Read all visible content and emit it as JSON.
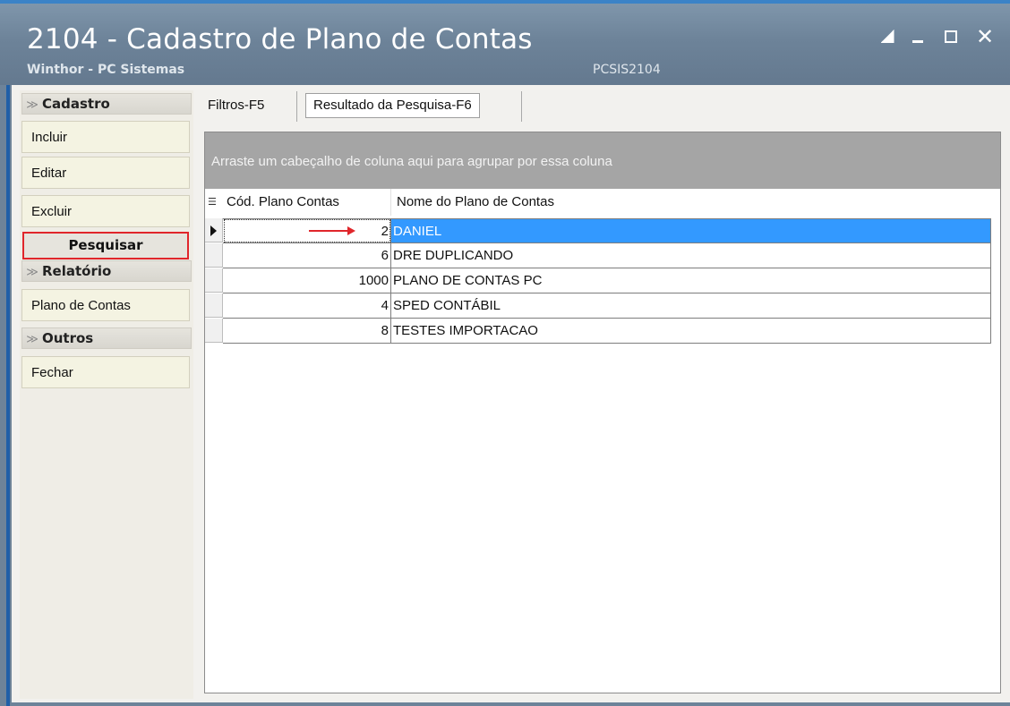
{
  "window": {
    "title": "2104 - Cadastro de Plano de Contas",
    "subtitle": "Winthor - PC Sistemas",
    "program_code": "PCSIS2104",
    "controls": [
      "restore-icon",
      "minimize-icon",
      "maximize-icon",
      "close-icon"
    ]
  },
  "sidebar": {
    "groups": [
      {
        "label": "Cadastro",
        "items": [
          {
            "label": "Incluir"
          },
          {
            "label": "Editar"
          },
          {
            "label": "Excluir"
          },
          {
            "label": "Pesquisar"
          }
        ]
      },
      {
        "label": "Relatório",
        "items": [
          {
            "label": "Plano de Contas"
          }
        ]
      },
      {
        "label": "Outros",
        "items": [
          {
            "label": "Fechar"
          }
        ]
      }
    ],
    "highlight_color": "#e0262b"
  },
  "tabs": [
    {
      "label": "Filtros-F5"
    },
    {
      "label": "Resultado da Pesquisa-F6"
    }
  ],
  "grid": {
    "group_panel_text": "Arraste um cabeçalho de coluna aqui para agrupar por essa coluna",
    "columns": [
      "Cód. Plano Contas",
      "Nome do Plano de Contas"
    ],
    "rows": [
      {
        "cod": "2",
        "nome": "DANIEL"
      },
      {
        "cod": "6",
        "nome": "DRE DUPLICANDO"
      },
      {
        "cod": "1000",
        "nome": "PLANO DE CONTAS PC"
      },
      {
        "cod": "4",
        "nome": "SPED CONTÁBIL"
      },
      {
        "cod": "8",
        "nome": "TESTES IMPORTACAO"
      }
    ],
    "selected_row": 0,
    "selection_color": "#3399ff"
  }
}
